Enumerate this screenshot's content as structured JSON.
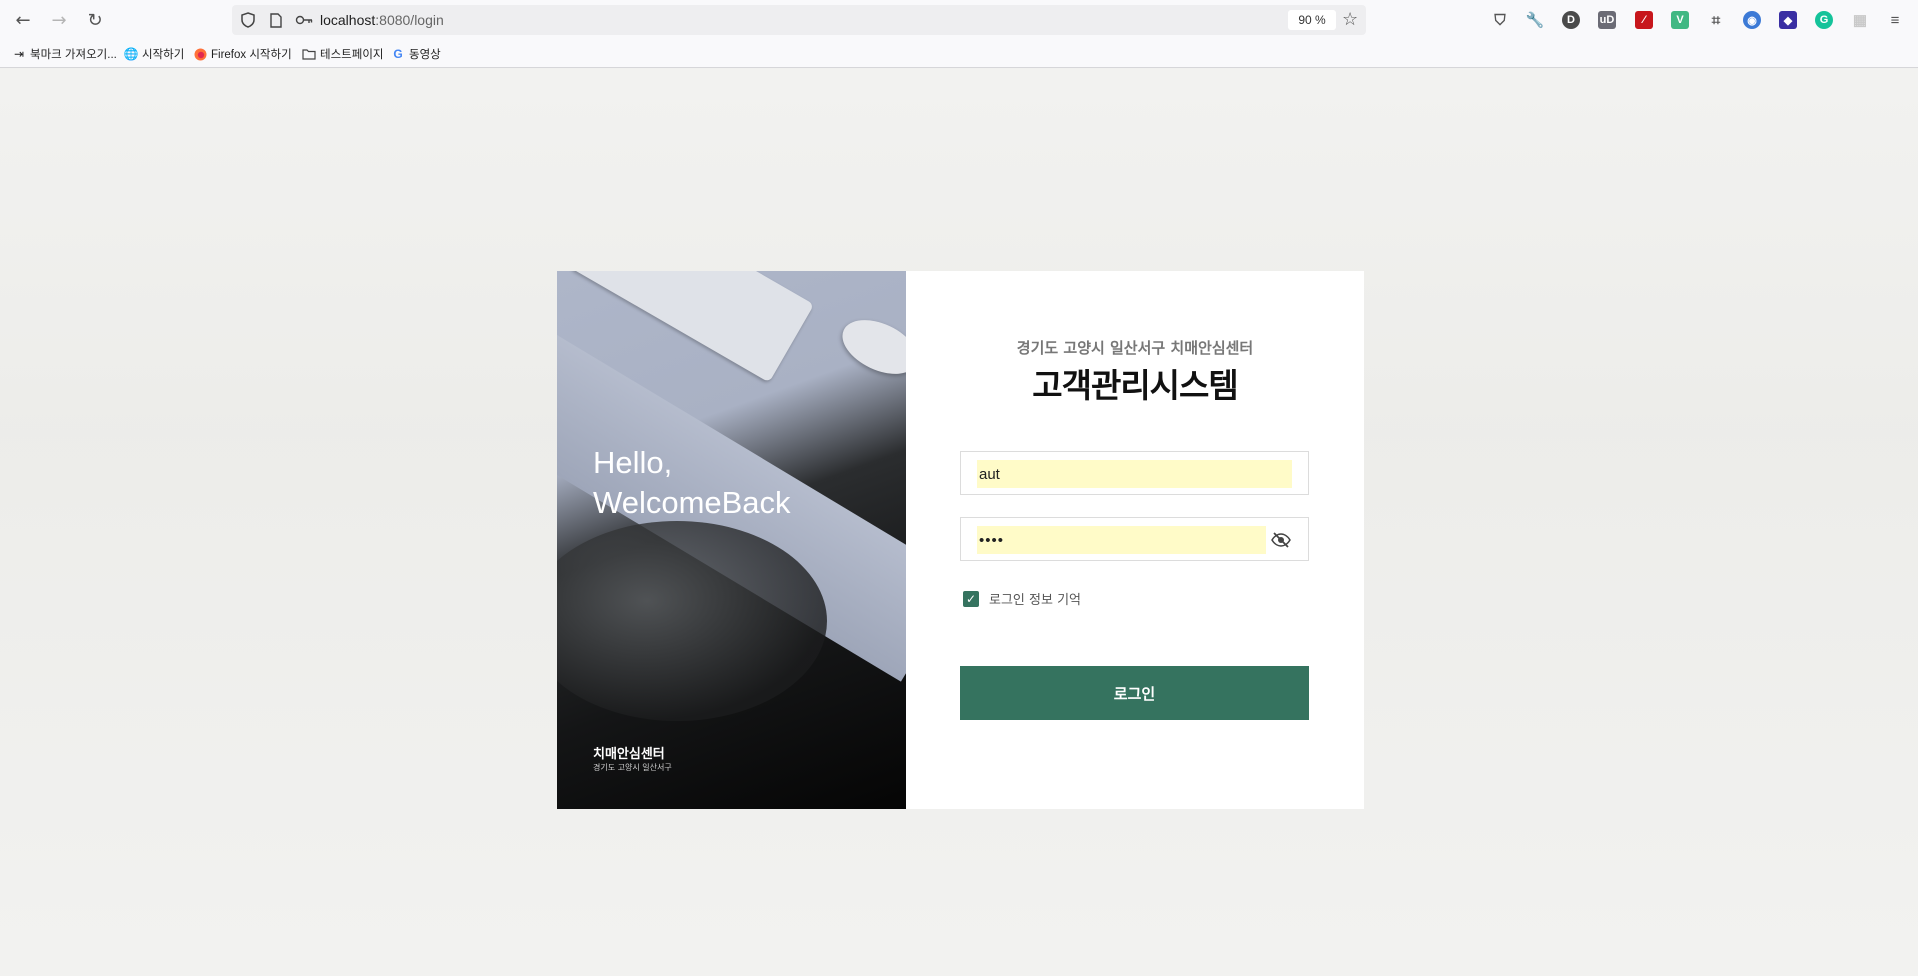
{
  "browser": {
    "url_host": "localhost",
    "url_rest": ":8080/login",
    "zoom": "90 %",
    "icons": {
      "back": "back-arrow-icon",
      "forward": "forward-arrow-icon",
      "reload": "reload-icon",
      "shield": "shield-icon",
      "page": "page-icon",
      "key": "key-icon",
      "bookmark_star": "star-icon"
    },
    "extensions": [
      {
        "name": "pocket-icon",
        "glyph": "⛉",
        "color": "#555555"
      },
      {
        "name": "wrench-icon",
        "glyph": "🔧",
        "color": "#555555"
      },
      {
        "name": "d-extension-icon",
        "glyph": "D",
        "color": "#4a4a4a"
      },
      {
        "name": "ublock-icon",
        "glyph": "uD",
        "color": "#6b6b75"
      },
      {
        "name": "red-extension-icon",
        "glyph": "⁄",
        "color": "#c7161c"
      },
      {
        "name": "vue-devtools-icon",
        "glyph": "V",
        "color": "#41b883"
      },
      {
        "name": "crop-icon",
        "glyph": "⌗",
        "color": "#555555"
      },
      {
        "name": "chrome-like-icon",
        "glyph": "◉",
        "color": "#3c7ad6"
      },
      {
        "name": "diamond-extension-icon",
        "glyph": "◆",
        "color": "#3a2fa3"
      },
      {
        "name": "grammarly-icon",
        "glyph": "G",
        "color": "#15c39a"
      },
      {
        "name": "grid-extension-icon",
        "glyph": "▦",
        "color": "#c9c9c9"
      },
      {
        "name": "menu-icon",
        "glyph": "≡",
        "color": "#555555"
      }
    ],
    "bookmarks": [
      {
        "label": "북마크 가져오기...",
        "icon": "import-icon"
      },
      {
        "label": "시작하기",
        "icon": "globe-icon"
      },
      {
        "label": "Firefox 시작하기",
        "icon": "firefox-icon"
      },
      {
        "label": "테스트페이지",
        "icon": "folder-icon"
      },
      {
        "label": "동영상",
        "icon": "google-icon"
      }
    ]
  },
  "login": {
    "hero_line1": "Hello,",
    "hero_line2": "WelcomeBack",
    "org_name": "치매안심센터",
    "org_location": "경기도 고양시 일산서구",
    "subtitle": "경기도 고양시 일산서구 치매안심센터",
    "title": "고객관리시스템",
    "username_value": "aut",
    "password_value": "••••",
    "remember_label": "로그인 정보 기억",
    "remember_checked": true,
    "login_button": "로그인",
    "accent_color": "#35735f",
    "autofill_color": "#fffbc8"
  }
}
